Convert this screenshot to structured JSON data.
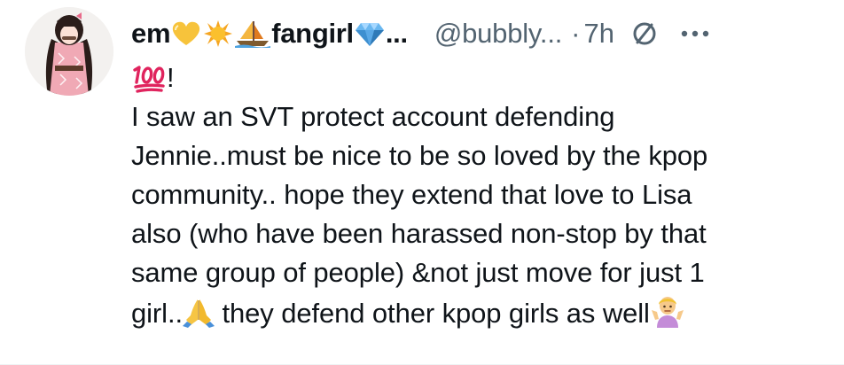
{
  "tweet": {
    "author": {
      "display_name_prefix": "em",
      "display_name_suffix": "fangirl",
      "ellipsis": "...",
      "handle": "@bubbly...",
      "separator": "·",
      "time": "7h",
      "name_emojis": [
        "yellow-heart",
        "sun",
        "sailboat",
        "gem"
      ],
      "avatar_icon": "anime-character-avatar"
    },
    "first_line_suffix": "!",
    "first_line_emoji": "hundred-points",
    "body_lines": [
      "I saw an SVT protect account defending",
      "Jennie..must be nice to be so loved by the kpop",
      "community.. hope they extend that love to Lisa",
      "also (who have been harassed non-stop by that",
      "same group of people) &not just move for just 1"
    ],
    "last_line": {
      "before_emoji": "girl..",
      "after_emoji": " they defend other kpop girls as well",
      "emojis": [
        "folded-hands",
        "person-shrugging"
      ]
    },
    "icons": {
      "block": "block-icon",
      "more": "more-icon"
    },
    "colors": {
      "text_primary": "#0f1419",
      "text_secondary": "#536471",
      "background": "#ffffff",
      "hundred_red": "#e0245e"
    }
  }
}
